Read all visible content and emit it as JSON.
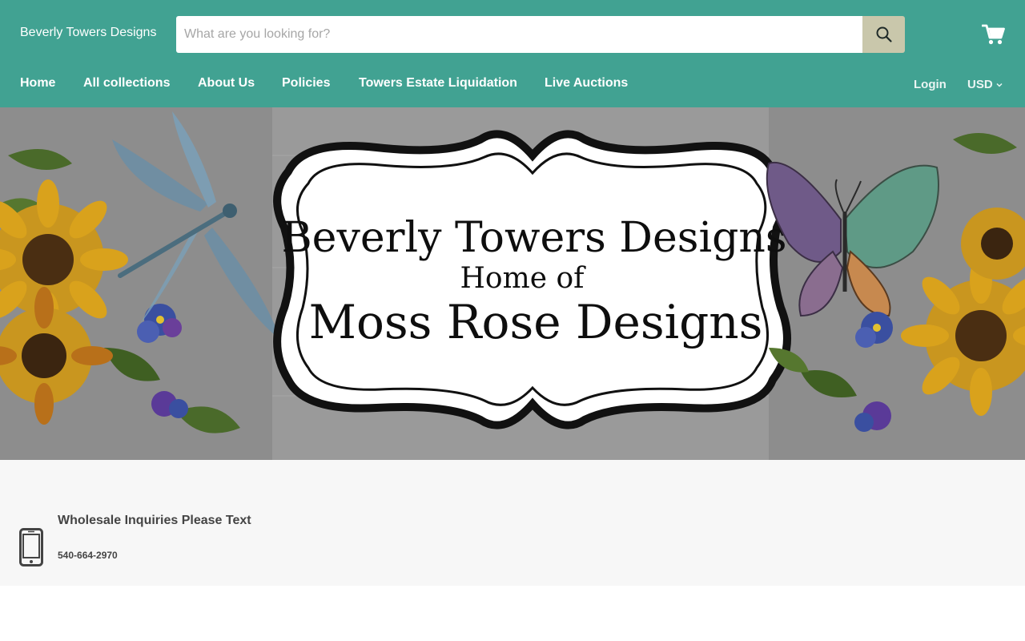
{
  "header": {
    "brand": "Beverly Towers Designs",
    "search": {
      "placeholder": "What are you looking for?",
      "value": ""
    },
    "icons": {
      "search": "search-icon",
      "cart": "cart-icon"
    }
  },
  "nav": {
    "items": [
      {
        "label": "Home"
      },
      {
        "label": "All collections"
      },
      {
        "label": "About Us"
      },
      {
        "label": "Policies"
      },
      {
        "label": "Towers Estate Liquidation"
      },
      {
        "label": "Live Auctions"
      }
    ],
    "login_label": "Login",
    "currency": "USD"
  },
  "hero": {
    "line1": "Beverly Towers Designs",
    "line2": "Home of",
    "line3": "Moss Rose Designs"
  },
  "info": {
    "title": "Wholesale Inquiries Please Text",
    "phone": "540-664-2970"
  },
  "colors": {
    "header_bg": "#41a292",
    "search_button": "#c9c7ab",
    "info_band": "#f7f7f7"
  }
}
